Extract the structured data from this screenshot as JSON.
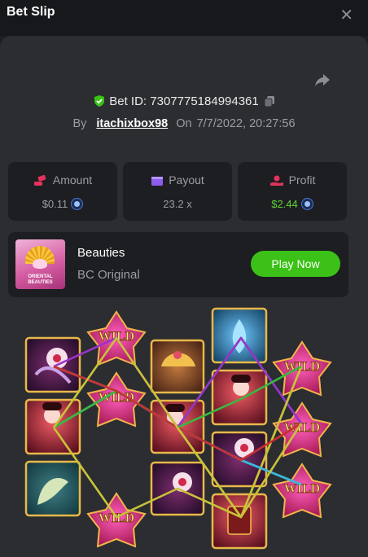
{
  "header": {
    "title": "Bet Slip",
    "close_glyph": "✕"
  },
  "bet": {
    "id_label": "Bet ID: 7307775184994361",
    "by_label": "By",
    "user": "itachixbox98",
    "on_label": "On",
    "date": "7/7/2022, 20:27:56"
  },
  "stats": {
    "amount": {
      "label": "Amount",
      "value": "$0.11",
      "icon": "money-hand-icon"
    },
    "payout": {
      "label": "Payout",
      "value": "23.2 x",
      "icon": "wallet-icon"
    },
    "profit": {
      "label": "Profit",
      "value": "$2.44",
      "icon": "profit-hand-icon"
    }
  },
  "game": {
    "name": "Beauties",
    "subtitle": "BC Original",
    "play_label": "Play Now",
    "thumb_title": "ORIENTAL BEAUTIES"
  },
  "colors": {
    "accent_green": "#3bc117",
    "profit_green": "#5ed534",
    "bg": "#1d1e21",
    "panel": "#2b2d31"
  },
  "board": {
    "wild_text": "WILD",
    "reels": [
      [
        "fan-symbol",
        "geisha-symbol",
        "fish-symbol"
      ],
      [
        "wild",
        "wild",
        "wild"
      ],
      [
        "comb-symbol",
        "geisha-symbol",
        "fan-symbol"
      ],
      [
        "lotus-symbol",
        "geisha-symbol",
        "fan-symbol",
        "scroll-symbol"
      ],
      [
        "wild",
        "wild",
        "wild"
      ]
    ]
  }
}
